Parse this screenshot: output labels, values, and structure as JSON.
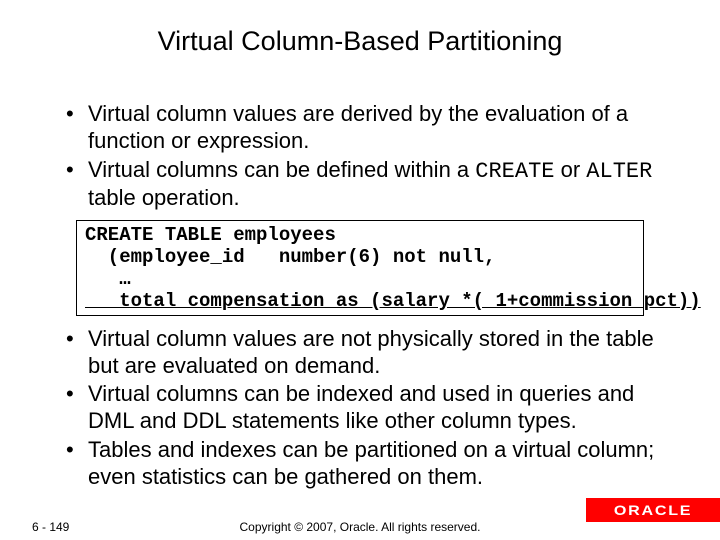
{
  "slide": {
    "title": "Virtual Column-Based Partitioning",
    "bullets_top": [
      {
        "text": "Virtual column values are derived by the evaluation of a function or expression."
      },
      {
        "prefix": "Virtual columns can be defined within a ",
        "code1": "CREATE",
        "mid": " or ",
        "code2": "ALTER",
        "suffix": " table operation."
      }
    ],
    "code": {
      "l1": "CREATE TABLE employees",
      "l2": "  (employee_id   number(6) not null,",
      "l3": "   …",
      "l4": "   total_compensation as (salary *( 1+commission_pct))"
    },
    "bullets_bottom": [
      "Virtual column values are not physically stored in the table but are evaluated on demand.",
      "Virtual columns can be indexed and used in queries and DML and DDL statements like other column types.",
      "Tables and indexes can be partitioned on a virtual column; even statistics can be gathered on them."
    ],
    "footer": {
      "page": "6 - 149",
      "copyright": "Copyright © 2007, Oracle. All rights reserved.",
      "brand": "ORACLE"
    }
  }
}
